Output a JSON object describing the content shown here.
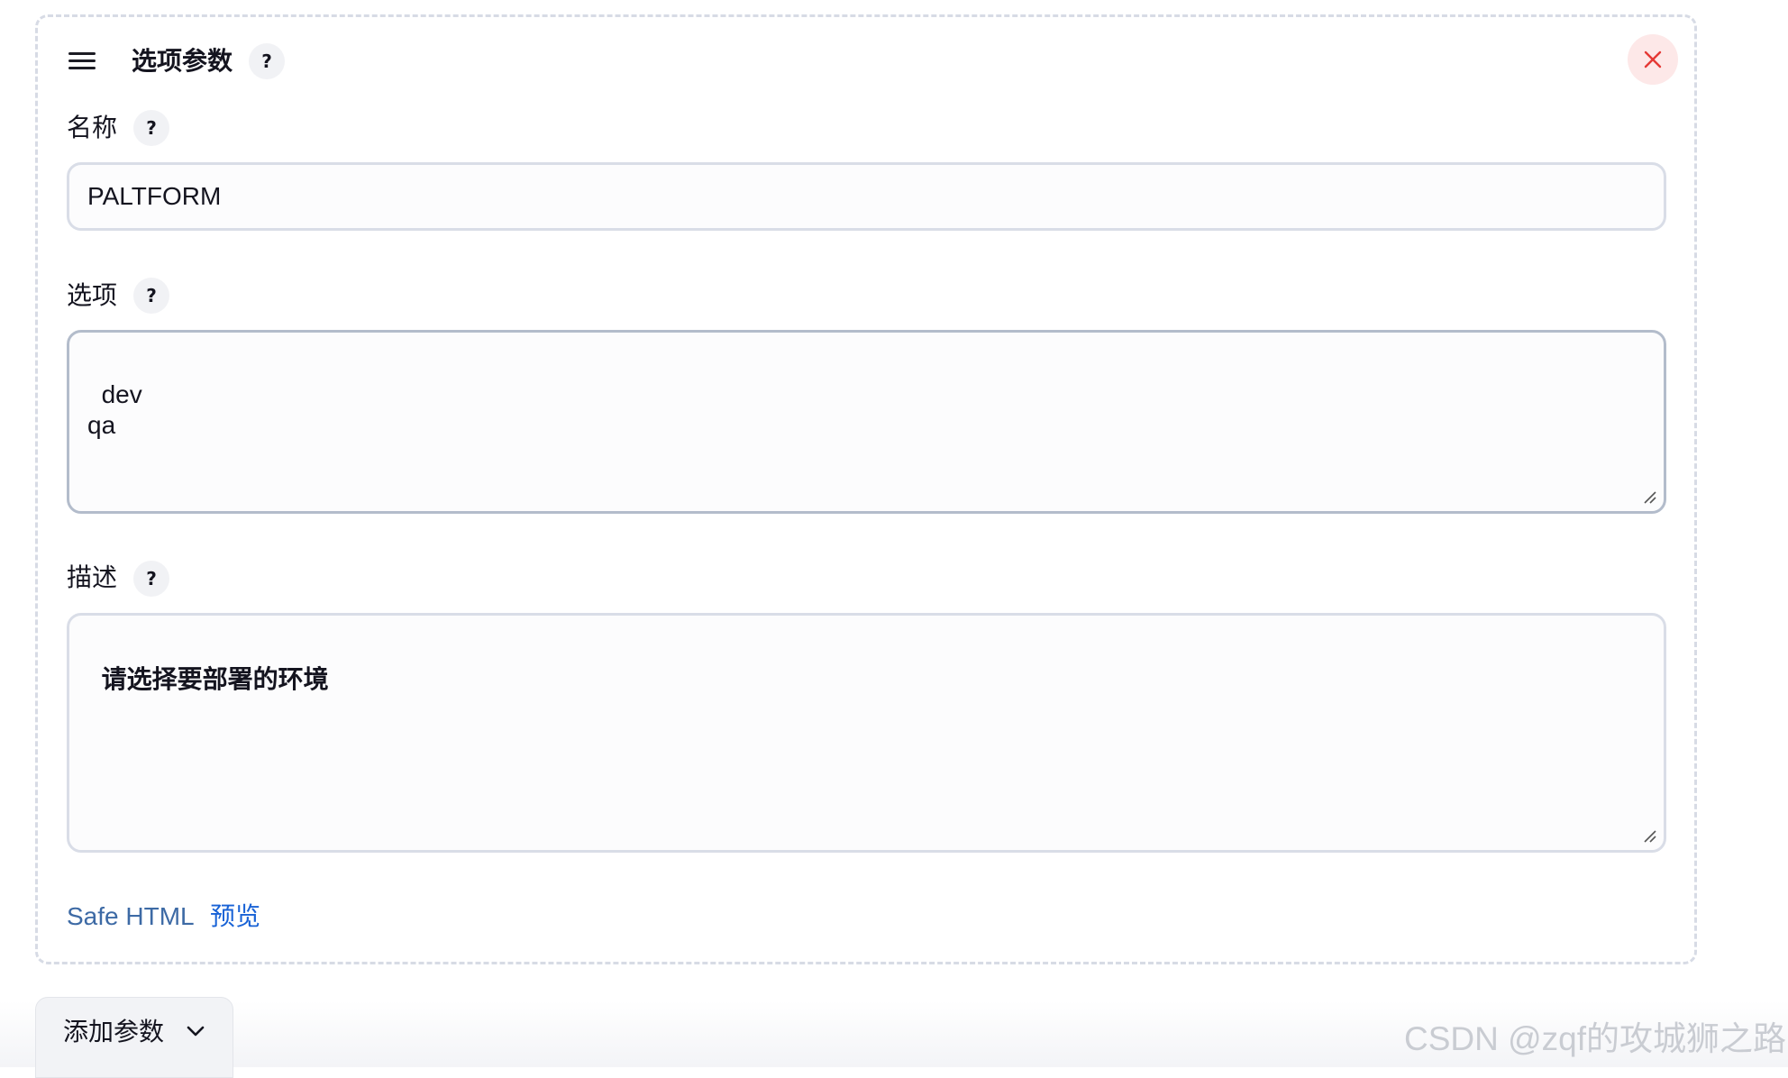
{
  "panel": {
    "title": "选项参数",
    "help_glyph": "?",
    "close_icon": "close-icon",
    "accent_close": "#e53935"
  },
  "fields": {
    "name": {
      "label": "名称",
      "value": "PALTFORM"
    },
    "choices": {
      "label": "选项",
      "value": "dev\nqa"
    },
    "description": {
      "label": "描述",
      "value": "请选择要部署的环境"
    }
  },
  "footer": {
    "safe_html": "Safe HTML",
    "preview": "预览"
  },
  "add_param": {
    "label": "添加参数",
    "icon": "chevron-down-icon"
  },
  "watermark": "CSDN @zqf的攻城狮之路"
}
